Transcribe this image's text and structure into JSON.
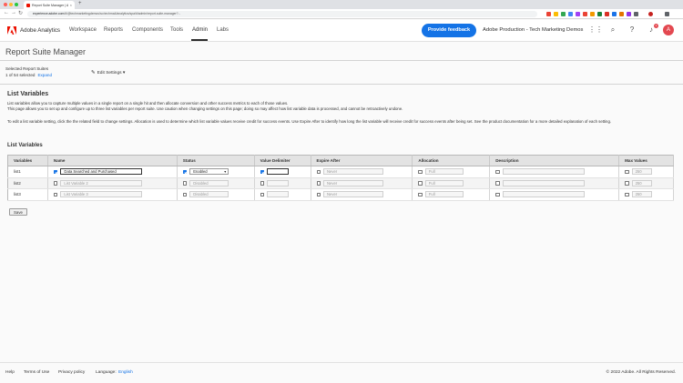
{
  "browser": {
    "tab_title": "Report Suite Manager | Adobe",
    "tab_close": "×",
    "new_tab": "+",
    "url_host": "experience.adobe.com",
    "url_path": "/#/@techmarketingdemos/so:techma4/analytics/spa/#/admin/report-suite-manager?...",
    "nav_back": "←",
    "nav_forward": "→",
    "nav_reload": "↻"
  },
  "header": {
    "product": "Adobe Analytics",
    "menu": [
      "Workspace",
      "Reports",
      "Components",
      "Tools",
      "Admin",
      "Labs"
    ],
    "active_menu": "Admin",
    "feedback_button": "Provide feedback",
    "org": "Adobe Production - Tech Marketing Demos",
    "notification_count": "1",
    "avatar_initial": "A",
    "icons": [
      "apps-icon",
      "search-icon",
      "help-icon",
      "bell-icon"
    ]
  },
  "page": {
    "title": "Report Suite Manager",
    "selected_label": "Selected Report Suites",
    "selected_count": "1 of 54 selected",
    "expand_link": "Expand",
    "edit_settings": "Edit Settings",
    "section_title": "List Variables",
    "desc_1": "List variables allow you to capture multiple values in a single report on a single hit and then allocate conversion and other success metrics to each of those values.",
    "desc_2": "This page allows you to set up and configure up to three list variables per report suite. Use caution when changing settings on this page; doing so may affect how list variable data is processed, and cannot be retroactively undone.",
    "desc_3": "To edit a list variable setting, click the the related field to change settings. Allocation is used to determine which list variable values receive credit for success events. Use Expire After to identify how long the list variable will receive credit for success events after being set. See the product documentation for a more detailed explanation of each setting.",
    "table_title": "List Variables",
    "save_button": "Save"
  },
  "table": {
    "headers": [
      "Variables",
      "Name",
      "Status",
      "Value Delimiter",
      "Expire After",
      "Allocation",
      "Description",
      "Max Values"
    ],
    "rows": [
      {
        "id": "list1",
        "name": "Data Searched and Purchased",
        "status": "Enabled",
        "delimiter": "",
        "expire": "Never",
        "allocation": "Full",
        "description": "",
        "max": "250"
      },
      {
        "id": "list2",
        "name": "List Variable 2",
        "status": "Disabled",
        "delimiter": "",
        "expire": "Never",
        "allocation": "Full",
        "description": "",
        "max": "250"
      },
      {
        "id": "list3",
        "name": "List Variable 3",
        "status": "Disabled",
        "delimiter": "",
        "expire": "Never",
        "allocation": "Full",
        "description": "",
        "max": "250"
      }
    ]
  },
  "footer": {
    "help": "Help",
    "terms": "Terms of Use",
    "privacy": "Privacy policy",
    "language_label": "Language:",
    "language_value": "English",
    "copyright": "© 2022 Adobe. All Rights Reserved."
  },
  "colors": {
    "accent": "#1473e6",
    "brand_red": "#eb1000"
  }
}
